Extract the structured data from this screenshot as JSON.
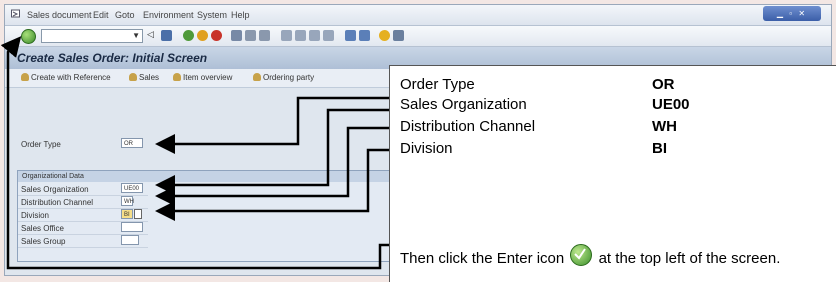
{
  "menu": {
    "items": [
      "Sales document",
      "Edit",
      "Goto",
      "Environment",
      "System",
      "Help"
    ]
  },
  "toolbar": {
    "icons": [
      "enter-icon",
      "command-field",
      "back-icon",
      "save-icon",
      "cancel-icon",
      "exit-icon",
      "print-icon",
      "find-icon",
      "page-icon",
      "layout-icon",
      "help-icon"
    ]
  },
  "screen": {
    "title": "Create Sales Order: Initial Screen",
    "app_buttons": [
      "Create with Reference",
      "Sales",
      "Item overview",
      "Ordering party"
    ]
  },
  "form": {
    "order_type_label": "Order Type",
    "order_type_value": "OR",
    "org_title": "Organizational Data",
    "fields": [
      {
        "label": "Sales Organization",
        "value": "UE00"
      },
      {
        "label": "Distribution Channel",
        "value": "WH"
      },
      {
        "label": "Division",
        "value": "BI"
      },
      {
        "label": "Sales Office",
        "value": ""
      },
      {
        "label": "Sales Group",
        "value": ""
      }
    ]
  },
  "callout": {
    "rows": [
      {
        "label": "Order Type",
        "value": "OR"
      },
      {
        "label": "Sales Organization",
        "value": "UE00"
      },
      {
        "label": "Distribution Channel",
        "value": "WH"
      },
      {
        "label": "Division",
        "value": "BI"
      }
    ],
    "note_before": "Then click the Enter icon",
    "note_after": "at the top left of the screen."
  },
  "colors": {
    "arrow": "#000000",
    "highlight": "#f6df8a",
    "enter_icon": "#3b8a2a"
  }
}
